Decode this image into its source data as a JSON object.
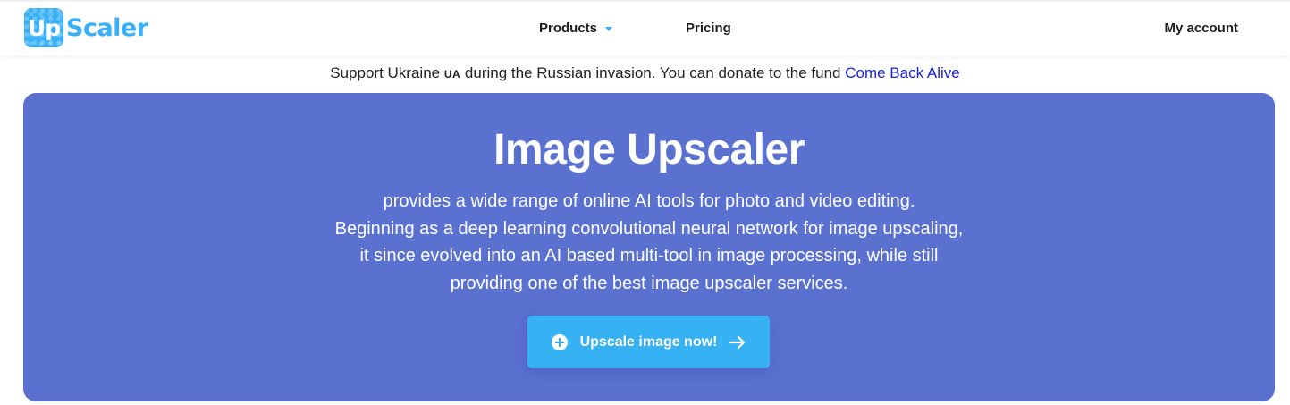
{
  "header": {
    "logo": {
      "badge": "Up",
      "text": "Scaler"
    },
    "nav": {
      "products": "Products",
      "pricing": "Pricing",
      "account": "My account"
    }
  },
  "notice": {
    "before": "Support Ukraine ",
    "flag": "UA",
    "after": " during the Russian invasion. You can donate to the fund ",
    "link": "Come Back Alive"
  },
  "hero": {
    "title": "Image Upscaler",
    "description": [
      "provides a wide range of online AI tools for photo and video editing.",
      "Beginning as a deep learning convolutional neural network for image upscaling,",
      "it since evolved into an AI based multi-tool in image processing, while still",
      "providing one of the best image upscaler services."
    ],
    "cta": "Upscale image now!"
  },
  "colors": {
    "brand": "#39b0f5",
    "hero_bg": "#5a71d0",
    "link": "#1a22d8"
  }
}
